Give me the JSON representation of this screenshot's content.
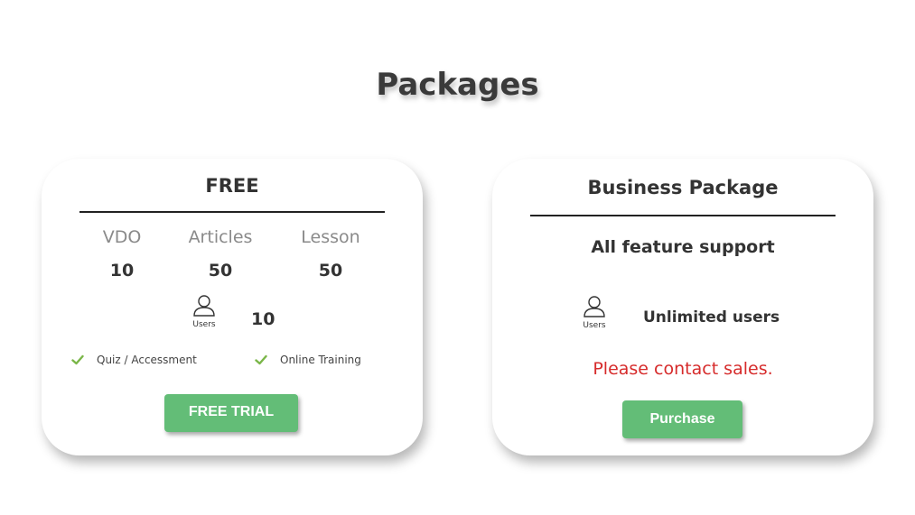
{
  "page": {
    "title": "Packages"
  },
  "free": {
    "title": "FREE",
    "stats": [
      {
        "label": "VDO",
        "value": "10"
      },
      {
        "label": "Articles",
        "value": "50"
      },
      {
        "label": "Lesson",
        "value": "50"
      }
    ],
    "users_caption": "Users",
    "users_count": "10",
    "features": [
      "Quiz / Accessment",
      "Online Training"
    ],
    "button_label": "FREE TRIAL"
  },
  "business": {
    "title": "Business Package",
    "subtitle": "All feature support",
    "users_caption": "Users",
    "users_text": "Unlimited users",
    "contact_text": "Please contact sales.",
    "button_label": "Purchase"
  },
  "colors": {
    "button": "#63bd77",
    "check": "#7ab648",
    "contact": "#d62b2b",
    "title": "#3a3a3a"
  },
  "icons": {
    "users": "user-icon",
    "feature": "check-icon"
  }
}
